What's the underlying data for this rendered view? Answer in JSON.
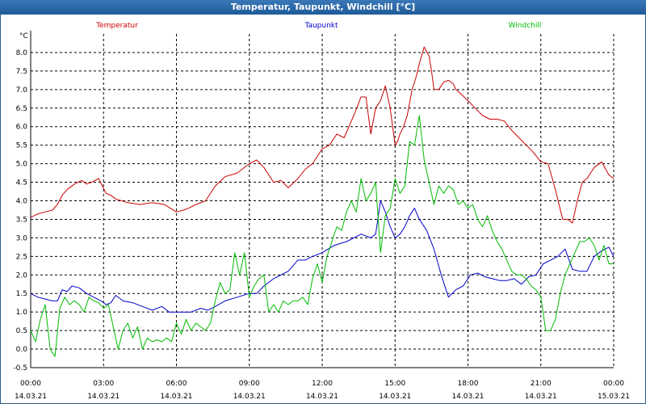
{
  "window": {
    "title": "Temperatur, Taupunkt, Windchill [°C]"
  },
  "chart_data": {
    "type": "line",
    "title": "Temperatur, Taupunkt, Windchill [°C]",
    "ylabel": "°C",
    "ylim": [
      -0.5,
      8.5
    ],
    "yticks": [
      "-0.5",
      "0.0",
      "0.5",
      "1.0",
      "1.5",
      "2.0",
      "2.5",
      "3.0",
      "3.5",
      "4.0",
      "4.5",
      "5.0",
      "5.5",
      "6.0",
      "6.5",
      "7.0",
      "7.5",
      "8.0"
    ],
    "xlim": [
      0,
      24
    ],
    "xticks": [
      {
        "time": "00:00",
        "date": "14.03.21"
      },
      {
        "time": "03:00",
        "date": "14.03.21"
      },
      {
        "time": "06:00",
        "date": "14.03.21"
      },
      {
        "time": "09:00",
        "date": "14.03.21"
      },
      {
        "time": "12:00",
        "date": "14.03.21"
      },
      {
        "time": "15:00",
        "date": "14.03.21"
      },
      {
        "time": "18:00",
        "date": "14.03.21"
      },
      {
        "time": "21:00",
        "date": "14.03.21"
      },
      {
        "time": "00:00",
        "date": "15.03.21"
      }
    ],
    "grid": true,
    "series": [
      {
        "name": "Temperatur",
        "color": "#cc0000",
        "x": [
          0,
          0.3,
          0.6,
          0.9,
          1.1,
          1.3,
          1.5,
          1.8,
          2.1,
          2.3,
          2.5,
          2.8,
          3.1,
          3.3,
          3.5,
          4.0,
          4.5,
          5.0,
          5.5,
          6.0,
          6.3,
          6.5,
          6.8,
          7.2,
          7.6,
          8.0,
          8.5,
          9.0,
          9.3,
          9.6,
          10.0,
          10.3,
          10.6,
          11.0,
          11.3,
          11.6,
          12.0,
          12.3,
          12.6,
          12.9,
          13.1,
          13.3,
          13.6,
          13.8,
          14.0,
          14.2,
          14.4,
          14.6,
          14.8,
          15.0,
          15.1,
          15.2,
          15.35,
          15.5,
          15.7,
          15.85,
          16.0,
          16.2,
          16.4,
          16.5,
          16.6,
          16.8,
          17.0,
          17.2,
          17.4,
          17.5,
          17.6,
          18.0,
          18.3,
          18.6,
          18.9,
          19.2,
          19.5,
          19.8,
          20.1,
          20.4,
          20.7,
          21.0,
          21.3,
          21.6,
          21.9,
          22.1,
          22.3,
          22.5,
          22.7,
          22.9,
          23.2,
          23.5,
          23.8,
          24.0
        ],
        "values": [
          3.55,
          3.65,
          3.7,
          3.75,
          3.9,
          4.15,
          4.3,
          4.45,
          4.55,
          4.45,
          4.5,
          4.6,
          4.2,
          4.15,
          4.05,
          3.95,
          3.9,
          3.95,
          3.9,
          3.7,
          3.75,
          3.8,
          3.9,
          4.0,
          4.4,
          4.65,
          4.75,
          5.0,
          5.1,
          4.9,
          4.5,
          4.55,
          4.35,
          4.6,
          4.85,
          5.0,
          5.4,
          5.5,
          5.8,
          5.7,
          6.0,
          6.3,
          6.8,
          6.8,
          5.8,
          6.5,
          6.7,
          7.1,
          6.5,
          5.5,
          5.6,
          5.8,
          6.0,
          6.3,
          7.0,
          7.3,
          7.7,
          8.15,
          7.9,
          7.5,
          7.0,
          7.0,
          7.2,
          7.25,
          7.15,
          7.0,
          6.95,
          6.7,
          6.5,
          6.3,
          6.2,
          6.2,
          6.15,
          5.9,
          5.7,
          5.5,
          5.3,
          5.05,
          5.0,
          4.3,
          3.5,
          3.5,
          3.4,
          4.0,
          4.5,
          4.6,
          4.9,
          5.05,
          4.7,
          4.6
        ]
      },
      {
        "name": "Taupunkt",
        "color": "#0000cc",
        "x": [
          0,
          0.3,
          0.6,
          0.9,
          1.1,
          1.3,
          1.5,
          1.7,
          2.0,
          2.3,
          2.6,
          2.9,
          3.1,
          3.3,
          3.5,
          3.8,
          4.2,
          4.6,
          5.0,
          5.4,
          5.7,
          6.0,
          6.3,
          6.6,
          7.0,
          7.3,
          7.6,
          8.0,
          8.5,
          9.0,
          9.3,
          9.6,
          10.0,
          10.3,
          10.6,
          11.0,
          11.3,
          11.6,
          12.0,
          12.5,
          13.0,
          13.3,
          13.6,
          14.0,
          14.2,
          14.4,
          14.6,
          14.8,
          15.0,
          15.2,
          15.4,
          15.6,
          15.8,
          16.0,
          16.3,
          16.6,
          16.9,
          17.2,
          17.5,
          17.8,
          18.1,
          18.4,
          18.7,
          19.0,
          19.3,
          19.6,
          19.9,
          20.2,
          20.5,
          20.8,
          21.1,
          21.4,
          21.7,
          22.0,
          22.3,
          22.6,
          22.9,
          23.2,
          23.5,
          23.8,
          24.0
        ],
        "values": [
          1.5,
          1.4,
          1.35,
          1.3,
          1.3,
          1.6,
          1.55,
          1.7,
          1.65,
          1.5,
          1.4,
          1.3,
          1.2,
          1.25,
          1.45,
          1.3,
          1.25,
          1.15,
          1.05,
          1.15,
          1.0,
          1.0,
          1.0,
          1.0,
          1.1,
          1.05,
          1.15,
          1.3,
          1.4,
          1.5,
          1.5,
          1.7,
          1.9,
          2.0,
          2.1,
          2.4,
          2.4,
          2.5,
          2.6,
          2.8,
          2.9,
          3.0,
          3.1,
          3.0,
          3.1,
          4.0,
          3.7,
          3.3,
          3.0,
          3.1,
          3.3,
          3.6,
          3.8,
          3.5,
          3.2,
          2.7,
          2.0,
          1.4,
          1.6,
          1.7,
          2.0,
          2.05,
          1.95,
          1.9,
          1.85,
          1.85,
          1.9,
          1.75,
          1.95,
          2.0,
          2.3,
          2.4,
          2.5,
          2.7,
          2.15,
          2.1,
          2.1,
          2.5,
          2.65,
          2.75,
          2.5
        ]
      },
      {
        "name": "Windchill",
        "color": "#00bb00",
        "x": [
          0,
          0.2,
          0.4,
          0.6,
          0.8,
          1.0,
          1.2,
          1.4,
          1.6,
          1.8,
          2.0,
          2.2,
          2.4,
          2.6,
          2.8,
          3.0,
          3.2,
          3.4,
          3.6,
          3.8,
          4.0,
          4.2,
          4.4,
          4.6,
          4.8,
          5.0,
          5.2,
          5.4,
          5.6,
          5.8,
          6.0,
          6.2,
          6.4,
          6.6,
          6.8,
          7.0,
          7.2,
          7.4,
          7.6,
          7.8,
          8.0,
          8.2,
          8.4,
          8.6,
          8.8,
          9.0,
          9.2,
          9.4,
          9.6,
          9.8,
          10.0,
          10.2,
          10.4,
          10.6,
          10.8,
          11.0,
          11.2,
          11.4,
          11.6,
          11.8,
          12.0,
          12.2,
          12.4,
          12.6,
          12.8,
          13.0,
          13.2,
          13.4,
          13.6,
          13.8,
          14.0,
          14.2,
          14.4,
          14.6,
          14.8,
          15.0,
          15.2,
          15.4,
          15.6,
          15.8,
          16.0,
          16.2,
          16.4,
          16.6,
          16.8,
          17.0,
          17.2,
          17.4,
          17.6,
          17.8,
          18.0,
          18.2,
          18.4,
          18.6,
          18.8,
          19.0,
          19.2,
          19.4,
          19.6,
          19.8,
          20.0,
          20.2,
          20.4,
          20.6,
          20.8,
          21.0,
          21.2,
          21.4,
          21.6,
          21.8,
          22.0,
          22.2,
          22.4,
          22.6,
          22.8,
          23.0,
          23.2,
          23.4,
          23.6,
          23.8,
          24.0
        ],
        "values": [
          0.5,
          0.2,
          0.8,
          1.2,
          0.0,
          -0.2,
          1.1,
          1.4,
          1.2,
          1.3,
          1.2,
          1.0,
          1.4,
          1.3,
          1.25,
          1.1,
          1.2,
          0.6,
          0.0,
          0.5,
          0.7,
          0.3,
          0.6,
          0.0,
          0.3,
          0.2,
          0.25,
          0.2,
          0.3,
          0.2,
          0.7,
          0.4,
          0.8,
          0.5,
          0.7,
          0.6,
          0.5,
          0.7,
          1.3,
          1.8,
          1.5,
          1.6,
          2.6,
          2.0,
          2.6,
          1.4,
          1.7,
          1.9,
          2.0,
          1.0,
          1.2,
          1.0,
          1.3,
          1.2,
          1.3,
          1.3,
          1.4,
          1.2,
          1.9,
          2.3,
          1.8,
          2.5,
          2.9,
          3.3,
          3.2,
          3.7,
          4.0,
          3.7,
          4.6,
          4.0,
          4.2,
          4.5,
          2.6,
          3.6,
          3.8,
          4.6,
          4.2,
          4.4,
          5.6,
          5.5,
          6.3,
          5.1,
          4.5,
          3.9,
          4.4,
          4.2,
          4.4,
          4.3,
          3.9,
          4.0,
          3.8,
          3.9,
          3.5,
          3.3,
          3.6,
          3.2,
          2.9,
          2.7,
          2.4,
          2.1,
          2.0,
          2.0,
          1.9,
          1.7,
          1.6,
          1.4,
          0.5,
          0.5,
          0.8,
          1.5,
          2.0,
          2.3,
          2.6,
          2.9,
          2.9,
          3.0,
          2.8,
          2.4,
          2.8,
          2.3,
          2.3
        ]
      }
    ]
  }
}
